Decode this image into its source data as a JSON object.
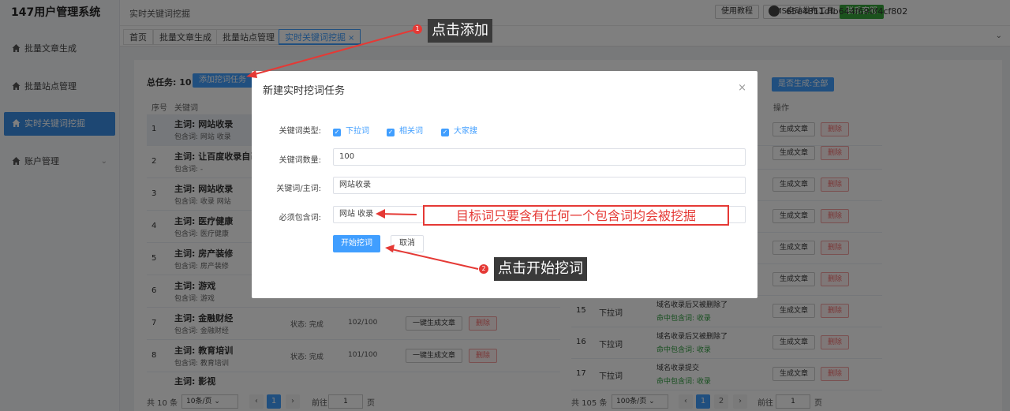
{
  "app": {
    "title": "147用户管理系统"
  },
  "sidebar": {
    "items": [
      {
        "label": "批量文章生成"
      },
      {
        "label": "批量站点管理"
      },
      {
        "label": "实时关键词挖掘"
      },
      {
        "label": "账户管理"
      }
    ]
  },
  "header": {
    "breadcrumb": "实时关键词挖掘",
    "buttons": {
      "tutorial": "使用教程",
      "cms": "CMS自动发布工具",
      "support": "联系客服"
    },
    "user_id": "65e4811dfb644f690f4cf802"
  },
  "tabs": [
    {
      "label": "首页"
    },
    {
      "label": "批量文章生成"
    },
    {
      "label": "批量站点管理"
    },
    {
      "label": "实时关键词挖掘",
      "close": "×"
    }
  ],
  "left_table": {
    "summary": "总任务: 10",
    "add_button": "添加挖词任务",
    "headers": {
      "no": "序号",
      "keyword": "关键词"
    },
    "rows": [
      {
        "no": "1",
        "main": "主词: 网站收录",
        "include": "包含词: 网站 收录"
      },
      {
        "no": "2",
        "main": "主词: 让百度收录自己",
        "include": "包含词: -"
      },
      {
        "no": "3",
        "main": "主词: 网站收录",
        "include": "包含词: 收录 网站"
      },
      {
        "no": "4",
        "main": "主词: 医疗健康",
        "include": "包含词: 医疗健康"
      },
      {
        "no": "5",
        "main": "主词: 房产装修",
        "include": "包含词: 房产装修"
      },
      {
        "no": "6",
        "main": "主词: 游戏",
        "include": "包含词: 游戏"
      },
      {
        "no": "7",
        "main": "主词: 金融财经",
        "include": "包含词: 金融财经",
        "status": "状态: 完成",
        "count": "102/100",
        "gen": "一键生成文章",
        "del": "删除"
      },
      {
        "no": "8",
        "main": "主词: 教育培训",
        "include": "包含词: 教育培训",
        "status": "状态: 完成",
        "count": "101/100",
        "gen": "一键生成文章",
        "del": "删除"
      },
      {
        "no": "",
        "main": "主词: 影视",
        "include": ""
      }
    ],
    "pager": {
      "total": "共 10 条",
      "size": "10条/页",
      "page": "1",
      "goto": "前往",
      "goto_value": "1",
      "page_unit": "页"
    }
  },
  "right_table": {
    "filter_button": "是否生成:全部",
    "header_op": "操作",
    "gen": "生成文章",
    "del": "删除",
    "rows": [
      {
        "no": "15",
        "type": "下拉词",
        "keyword": "域名收录后又被删除了",
        "hit": "命中包含词: 收录"
      },
      {
        "no": "16",
        "type": "下拉词",
        "keyword": "域名收录后又被删除了",
        "hit": "命中包含词: 收录"
      },
      {
        "no": "17",
        "type": "下拉词",
        "keyword": "域名收录提交",
        "hit": "命中包含词: 收录"
      }
    ],
    "pager": {
      "total": "共 105 条",
      "size": "100条/页",
      "page1": "1",
      "page2": "2",
      "goto": "前往",
      "goto_value": "1",
      "page_unit": "页"
    }
  },
  "modal": {
    "title": "新建实时挖词任务",
    "close": "×",
    "type_label": "关键词类型:",
    "types": [
      "下拉词",
      "相关词",
      "大家搜"
    ],
    "count_label": "关键词数量:",
    "count_value": "100",
    "main_label": "关键词/主词:",
    "main_value": "网站收录",
    "include_label": "必须包含词:",
    "include_value": "网站 收录",
    "start_button": "开始挖词",
    "cancel_button": "取消"
  },
  "annotations": {
    "badge1": "1",
    "callout1": "点击添加",
    "callout_include": "目标词只要含有任何一个包含词均会被挖掘",
    "badge2": "2",
    "callout2": "点击开始挖词"
  },
  "colors": {
    "accent": "#409eff",
    "sidebar_active": "#3a8ee6",
    "green": "#36a53a",
    "danger": "#e53935"
  }
}
